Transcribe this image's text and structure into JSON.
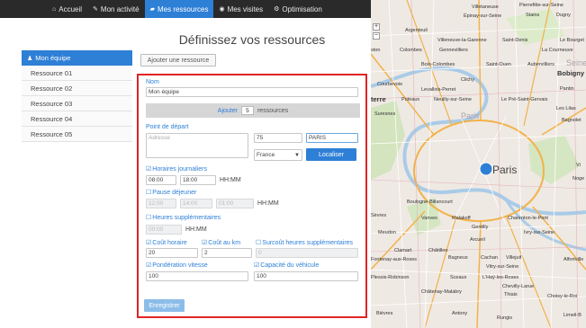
{
  "nav": {
    "items": [
      {
        "label": "Accueil",
        "icon": "home-icon"
      },
      {
        "label": "Mon activité",
        "icon": "pencil-icon"
      },
      {
        "label": "Mes ressources",
        "icon": "car-icon",
        "active": true
      },
      {
        "label": "Mes visites",
        "icon": "map-marker-icon"
      },
      {
        "label": "Optimisation",
        "icon": "gear-icon"
      }
    ]
  },
  "page": {
    "title": "Définissez vos ressources"
  },
  "sidebar": {
    "items": [
      {
        "label": "Mon équipe",
        "active": true
      },
      {
        "label": "Ressource 01"
      },
      {
        "label": "Ressource 02"
      },
      {
        "label": "Ressource 03"
      },
      {
        "label": "Ressource 04"
      },
      {
        "label": "Ressource 05"
      }
    ]
  },
  "toolbar": {
    "add_resource_label": "Ajouter une ressource"
  },
  "form": {
    "nom_label": "Nom",
    "nom_value": "Mon équipe",
    "ajouter_label": "Ajouter",
    "ajouter_count": "5",
    "ajouter_suffix": "ressources",
    "depart_label": "Point de départ",
    "adresse_placeholder": "Adresse",
    "postal_value": "75",
    "city_value": "PARIS",
    "country_value": "France",
    "localiser_label": "Localiser",
    "horaires_label": "Horaires journaliers",
    "horaires_start": "08:00",
    "horaires_end": "18:00",
    "hhmm": "HH:MM",
    "pause_label": "Pause déjeuner",
    "pause_start": "12:00",
    "pause_end": "14:00",
    "pause_duration": "01:00",
    "supp_label": "Heures supplémentaires",
    "supp_value": "00:00",
    "cout_horaire_label": "Coût horaire",
    "cout_horaire_value": "20",
    "cout_km_label": "Coût au km",
    "cout_km_value": "2",
    "surcout_label": "Surcoût heures supplémentaires",
    "surcout_value": "0",
    "vitesse_label": "Pondération vitesse",
    "vitesse_value": "100",
    "capacite_label": "Capacité du véhicule",
    "capacite_value": "100",
    "save_label": "Enregistrer"
  },
  "map": {
    "zoom_in": "+",
    "zoom_out": "−",
    "center_label": "Paris",
    "ghost_label": "Paris",
    "labels": {
      "villetaneuse": "Villetaneuse",
      "pierrefitte": "Pierrefitte-sur-Seine",
      "epinay": "Épinay-sur-Seine",
      "stains": "Stains",
      "dugny": "Dugny",
      "argenteuil": "Argenteuil",
      "villeneuve": "Villeneuve-la-Garenne",
      "saint_denis": "Saint-Denis",
      "le_bourget": "Le Bourget",
      "colombes": "Colombes",
      "gennevilliers": "Gennevilliers",
      "la_courneuve": "La Courneuve",
      "bois_colombes": "Bois-Colombes",
      "saint_ouen": "Saint-Ouen",
      "aubervilliers": "Aubervilliers",
      "seine": "Seine",
      "bobigny": "Bobigny",
      "clichy": "Clichy",
      "courbevoie": "Courbevoie",
      "levallois": "Levallois-Perret",
      "pantin": "Pantin",
      "puteaux": "Puteaux",
      "neuilly": "Neuilly-sur-Seine",
      "pre_st_gervais": "Le Pré-Saint-Gervais",
      "les_lilas": "Les Lilas",
      "terre": "terre",
      "suresnes": "Suresnes",
      "bagnolet": "Bagnolet",
      "boulogne": "Boulogne-Billancourt",
      "sevres": "Sèvres",
      "vanves": "Vanves",
      "malakoff": "Malakoff",
      "charenton": "Charenton-le-Pont",
      "meudon": "Meudon",
      "gentilly": "Gentilly",
      "ivry": "Ivry-sur-Seine",
      "clamart": "Clamart",
      "chatillon": "Châtillon",
      "arcueil": "Arcueil",
      "fontenay": "Fontenay-aux-Roses",
      "bagneux": "Bagneux",
      "cachan": "Cachan",
      "villejuif": "Villejuif",
      "vitry": "Vitry-sur-Seine",
      "alfortville": "Alfortville",
      "plessis": "Plessis-Robinson",
      "sceaux": "Sceaux",
      "hay_les_roses": "L'Haÿ-les-Roses",
      "chevilly": "Chevilly-Larue",
      "thiais": "Thiais",
      "choisy": "Choisy-le-Roi",
      "chatenay": "Châtenay-Malabry",
      "bievres": "Bièvres",
      "antony": "Antony",
      "rungis": "Rungis",
      "limeil": "Limeil-B",
      "noge": "Noge",
      "vi": "Vi",
      "ston": "ston"
    }
  },
  "colors": {
    "accent": "#2e7fd6",
    "nav_bg": "#2a2a2a",
    "panel_border": "#e02424",
    "marker": "#2e7fd6"
  }
}
